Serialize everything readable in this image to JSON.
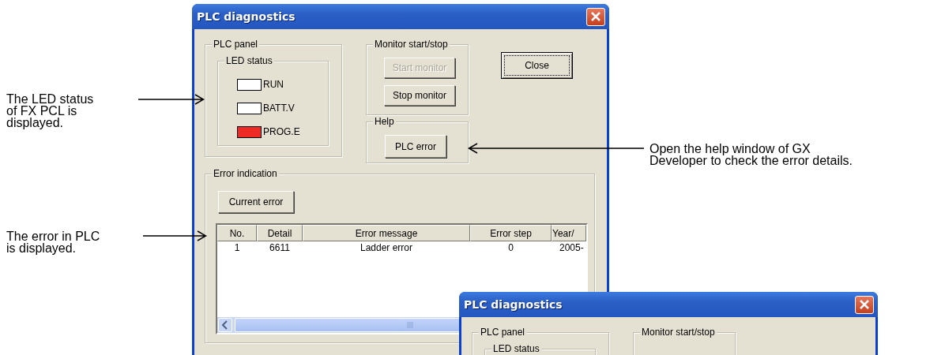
{
  "annotations": [
    {
      "text": "The LED status\nof FX PCL is\ndisplayed.",
      "arrow_points_left": false
    },
    {
      "text": "The error in PLC\nis displayed.",
      "arrow_points_left": false
    },
    {
      "text": "Open the help window of GX\nDeveloper to check the error details.",
      "arrow_points_left": true
    }
  ],
  "windows": [
    {
      "title": "PLC diagnostics",
      "plc_panel": {
        "label": "PLC panel",
        "led_status": {
          "label": "LED status",
          "leds": [
            {
              "label": "RUN",
              "lit": false
            },
            {
              "label": "BATT.V",
              "lit": false
            },
            {
              "label": "PROG.E",
              "lit": true
            }
          ]
        }
      },
      "monitor": {
        "label": "Monitor start/stop",
        "buttons": [
          {
            "label": "Start monitor",
            "disabled": true
          },
          {
            "label": "Stop monitor",
            "disabled": false
          }
        ]
      },
      "help": {
        "label": "Help",
        "buttons": [
          {
            "label": "PLC error",
            "disabled": false
          }
        ]
      },
      "close": {
        "label": "Close",
        "focused": true
      },
      "error_indication": {
        "label": "Error indication",
        "button": "Current error",
        "table": {
          "columns": [
            "No.",
            "Detail",
            "Error message",
            "Error step",
            "Year/"
          ],
          "rows": [
            [
              "1",
              "6611",
              "Ladder error",
              "0",
              "2005-"
            ]
          ]
        }
      }
    },
    {
      "title": "PLC diagnostics",
      "plc_panel": {
        "label": "PLC panel",
        "led_status": {
          "label": "LED status"
        }
      },
      "monitor": {
        "label": "Monitor start/stop"
      }
    }
  ]
}
